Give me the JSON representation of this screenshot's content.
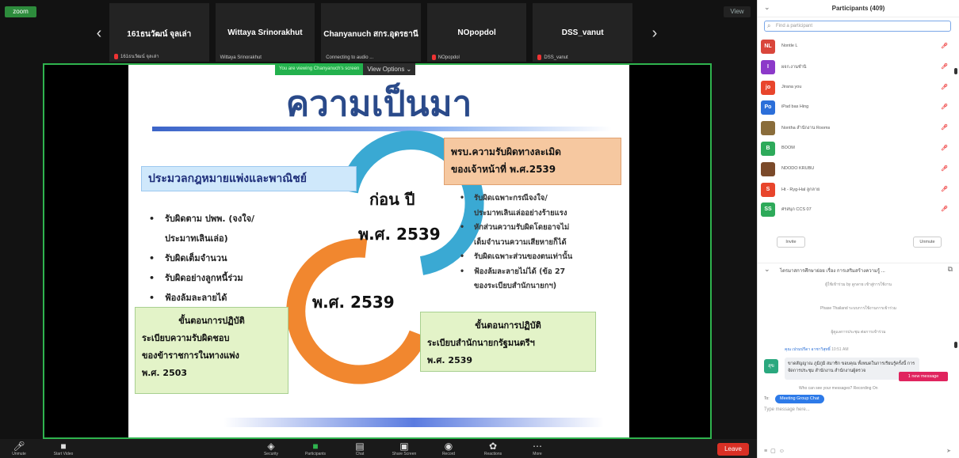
{
  "app": {
    "badge": "zoom"
  },
  "top": {
    "right_ctrl": "View",
    "prev_arrow": "‹",
    "next_arrow": "›",
    "thumbs": [
      {
        "name": "161ธนวัฒน์ จุลเล่า",
        "sub": "161ธนวัฒน์ จุลเล่า",
        "muted": true
      },
      {
        "name": "Wittaya Srinorakhut",
        "sub": "Wittaya Srinorakhut",
        "muted": false
      },
      {
        "name": "Chanyanuch สกร.อุดรธานี",
        "sub": "Connecting to audio ...",
        "muted": false
      },
      {
        "name": "NOpopdol",
        "sub": "NOpopdol",
        "muted": true
      },
      {
        "name": "DSS_vanut",
        "sub": "DSS_vanut",
        "muted": true
      }
    ]
  },
  "share_bar": {
    "note": "You are viewing Chanyanuch's screen",
    "view_options": "View Options ⌄"
  },
  "slide": {
    "title": "ความเป็นมา",
    "left_header": "ประมวลกฎหมายแพ่งและพาณิชย์",
    "left_items": [
      "รับผิดตาม ปพพ. (จงใจ/",
      "ประมาทเลินเล่อ)",
      "รับผิดเต็มจำนวน",
      "รับผิดอย่างลูกหนี้ร่วม",
      "ฟ้องล้มละลายได้"
    ],
    "left_bullets": [
      true,
      false,
      true,
      true,
      true
    ],
    "right_header_1": "พรบ.ความรับผิดทางละเมิด",
    "right_header_2": "ของเจ้าหน้าที่ พ.ศ.2539",
    "right_items": [
      "รับผิดเฉพาะกรณีจงใจ/",
      "ประมาทเลินเล่ออย่างร้ายแรง",
      "หักส่วนความรับผิดโดยอาจไม่",
      "เต็มจำนวนความเสียหายก็ได้",
      "รับผิดเฉพาะส่วนของตนเท่านั้น",
      "ฟ้องล้มละลายไม่ได้ (ข้อ 27",
      "ของระเบียบสำนักนายกฯ)"
    ],
    "right_bullets": [
      true,
      false,
      true,
      false,
      true,
      true,
      false
    ],
    "ring_before_1": "ก่อน ปี",
    "ring_before_2": "พ.ศ. 2539",
    "ring_after": "พ.ศ. 2539",
    "green_left": [
      "ขั้นตอนการปฏิบัติ",
      "ระเบียบความรับผิดชอบ",
      "ของข้าราชการในทางแพ่ง",
      "พ.ศ. 2503"
    ],
    "green_right": [
      "ขั้นตอนการปฏิบัติ",
      "ระเบียบสำนักนายกรัฐมนตรีฯ",
      "พ.ศ. 2539"
    ]
  },
  "toolbar": {
    "unmute": "Unmute",
    "start_video": "Start Video",
    "security": "Security",
    "participants": "Participants",
    "participants_count": "409",
    "chat": "Chat",
    "share": "Share Screen",
    "record": "Record",
    "reactions": "Reactions",
    "more": "More",
    "leave": "Leave"
  },
  "panel": {
    "title": "Participants (409)",
    "search_placeholder": "Find a participant",
    "participants": [
      {
        "initials": "NL",
        "color": "#d9463b",
        "name": "Nontle L"
      },
      {
        "initials": "I",
        "color": "#8c39c9",
        "name": "ผจก.งานชำนิ"
      },
      {
        "initials": "jo",
        "color": "#e8452c",
        "name": "Jirana you"
      },
      {
        "initials": "Po",
        "color": "#2c6fd9",
        "name": "iPad bas Hing"
      },
      {
        "initials": "",
        "color": "#8a6d3b",
        "name": "Nontha สำนักงาน Rooms"
      },
      {
        "initials": "B",
        "color": "#2eaa5a",
        "name": "BOOM"
      },
      {
        "initials": "",
        "color": "#7b4a2a",
        "name": "NDODO KRUBU"
      },
      {
        "initials": "S",
        "color": "#e8452c",
        "name": "Ht - Ryg-Hal ลูกลาย"
      },
      {
        "initials": "SS",
        "color": "#2eaa5a",
        "name": "ศรสนุก CCS 07"
      }
    ],
    "invite": "Invite",
    "unmute_me": "Unmute",
    "chat_title": "ไตรมาสการศึกษาย่อย เรื่อง การเสริมสร้างความรู้ ...",
    "system_msgs": [
      "ผู้ใช้เข้าร่วม by ลูกลาย เข้าสู่การใช้งาน",
      "Phase Thailand ระบบการใช้งานการเข้าร่วม",
      "ผู้ดูแลการประชุม ต่อการเข้าร่วม"
    ],
    "msg_sender": "คุณ เปรมปรีดา อาชาวิสุทธิ์",
    "msg_time": "10:51 AM",
    "msg_avatar": "สุข",
    "msg_text": "ขาดสัญญาณ ภูมิภูมิ สมาชิก ขอบคุณ ทั้งหมดในการเรียนรู้ครั้งนี้ การจัดการประชุม สำนักงาน สำนักงานผู้ตรวจ",
    "new_message": "1 new message",
    "private_note": "Who can see your messages? Recording On",
    "to_label": "To:",
    "to_chip": "Meeting Group Chat",
    "input_placeholder": "Type message here..."
  },
  "colors": {
    "share_green": "#2fb34e",
    "leave_red": "#d93025",
    "accent_blue": "#2d7ae8"
  }
}
